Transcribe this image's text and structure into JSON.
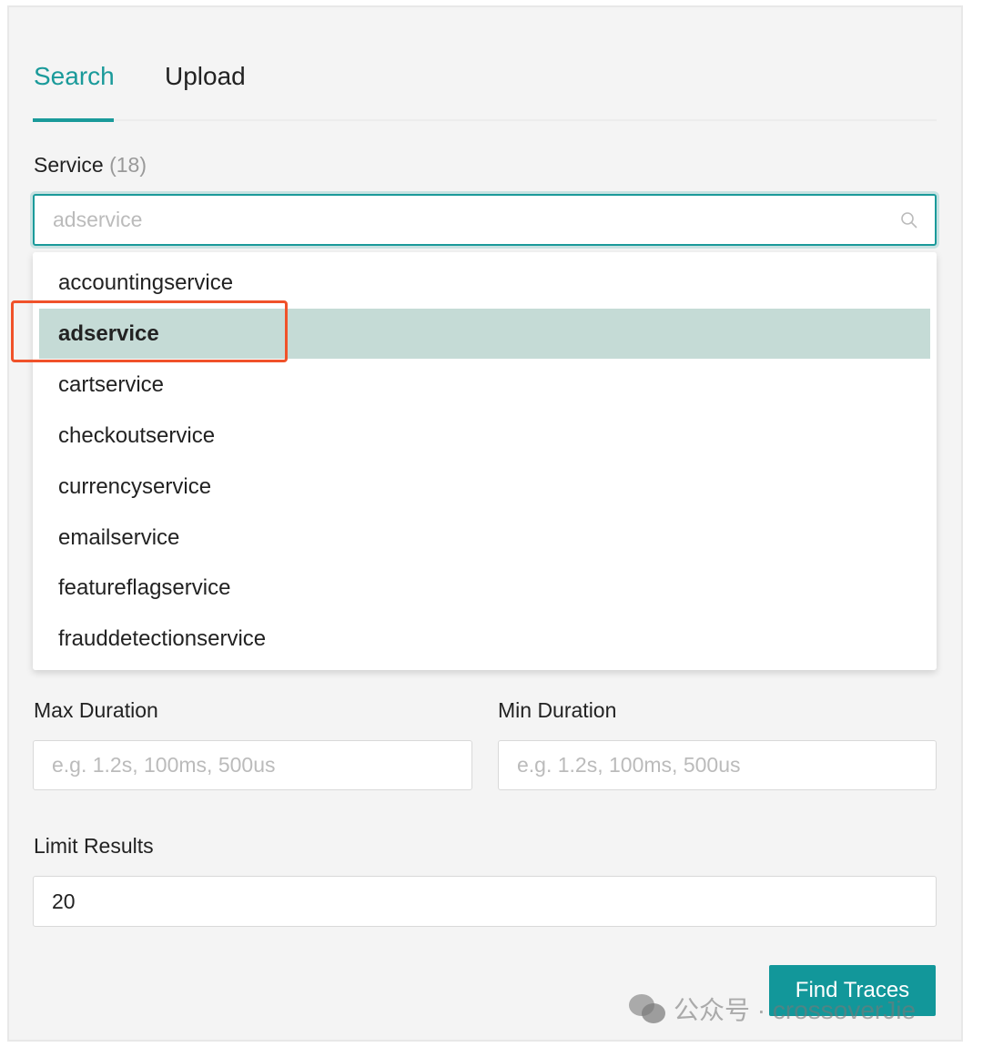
{
  "tabs": [
    {
      "label": "Search",
      "active": true
    },
    {
      "label": "Upload",
      "active": false
    }
  ],
  "service": {
    "label": "Service",
    "count": "(18)",
    "placeholder": "adservice",
    "options": [
      "accountingservice",
      "adservice",
      "cartservice",
      "checkoutservice",
      "currencyservice",
      "emailservice",
      "featureflagservice",
      "frauddetectionservice"
    ],
    "selected": "adservice"
  },
  "max_duration": {
    "label": "Max Duration",
    "placeholder": "e.g. 1.2s, 100ms, 500us"
  },
  "min_duration": {
    "label": "Min Duration",
    "placeholder": "e.g. 1.2s, 100ms, 500us"
  },
  "limit": {
    "label": "Limit Results",
    "value": "20"
  },
  "find_button": "Find Traces",
  "watermark": "公众号 · crossoverJie",
  "colors": {
    "accent": "#1a9a9a",
    "highlight": "#f0522a",
    "selected_bg": "#c5dbd6"
  }
}
